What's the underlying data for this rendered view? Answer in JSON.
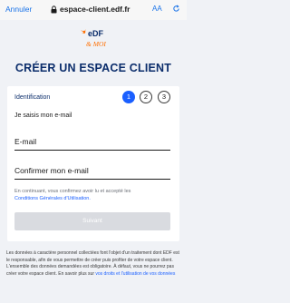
{
  "browser": {
    "cancel_label": "Annuler",
    "url": "espace-client.edf.fr",
    "text_size_label": "AA"
  },
  "logo": {
    "brand": "eDF",
    "tagline": "& MOI"
  },
  "page": {
    "title": "CRÉER UN ESPACE CLIENT"
  },
  "form": {
    "step_label": "Identification",
    "steps": [
      "1",
      "2",
      "3"
    ],
    "subheading": "Je saisis mon e-mail",
    "email_placeholder": "E-mail",
    "confirm_placeholder": "Confirmer mon e-mail",
    "consent_text": "En continuant, vous confirmez avoir lu et accepté les",
    "consent_link": "Conditions Générales d'Utilisation.",
    "submit_label": "Suivant"
  },
  "legal": {
    "text": "Les données à caractère personnel collectées font l'objet d'un traitement dont EDF est le responsable, afin de vous permettre de créer puis profiter de votre espace client. L'ensemble des données demandées est obligatoire. À défaut, vous ne pourrez pas créer votre espace client. En savoir plus sur",
    "link": "vos droits et l'utilisation de vos données"
  },
  "colors": {
    "brand_blue": "#0b2d6b",
    "accent_blue": "#1a5fff",
    "edf_orange": "#ff6f00"
  }
}
